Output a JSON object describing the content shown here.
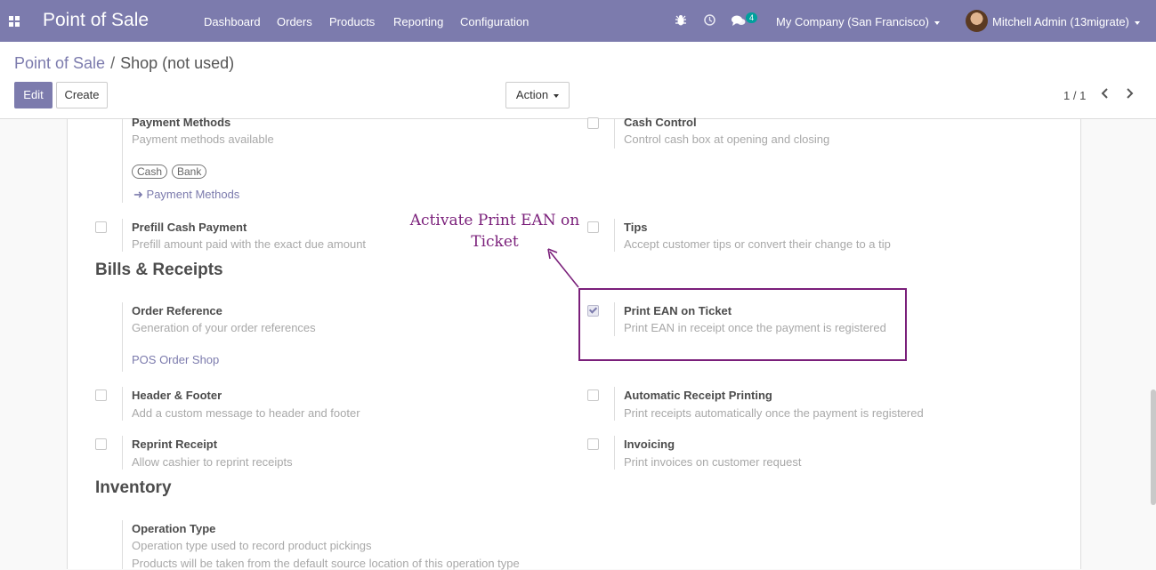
{
  "navbar": {
    "app_title": "Point of Sale",
    "menu": [
      "Dashboard",
      "Orders",
      "Products",
      "Reporting",
      "Configuration"
    ],
    "chat_count": "4",
    "company": "My Company (San Francisco)",
    "user": "Mitchell Admin (13migrate)",
    "colors": {
      "bar": "#7c7bad",
      "badge": "#00a09d"
    }
  },
  "breadcrumb": {
    "parent": "Point of Sale",
    "separator": "/",
    "current": "Shop (not used)"
  },
  "toolbar": {
    "edit": "Edit",
    "create": "Create",
    "action": "Action",
    "pager": "1 / 1"
  },
  "settings": {
    "payment_methods": {
      "label": "Payment Methods",
      "desc": "Payment methods available",
      "tags": [
        "Cash",
        "Bank"
      ],
      "link": "Payment Methods"
    },
    "cash_control": {
      "label": "Cash Control",
      "desc": "Control cash box at opening and closing",
      "checked": false
    },
    "prefill_cash": {
      "label": "Prefill Cash Payment",
      "desc": "Prefill amount paid with the exact due amount",
      "checked": false
    },
    "tips": {
      "label": "Tips",
      "desc": "Accept customer tips or convert their change to a tip",
      "checked": false
    }
  },
  "bills_section": {
    "title": "Bills & Receipts",
    "order_reference": {
      "label": "Order Reference",
      "desc": "Generation of your order references",
      "link": "POS Order Shop"
    },
    "print_ean": {
      "label": "Print EAN on Ticket",
      "desc": "Print EAN in receipt once the payment is registered",
      "checked": true
    },
    "header_footer": {
      "label": "Header & Footer",
      "desc": "Add a custom message to header and footer",
      "checked": false
    },
    "auto_receipt": {
      "label": "Automatic Receipt Printing",
      "desc": "Print receipts automatically once the payment is registered",
      "checked": false
    },
    "reprint": {
      "label": "Reprint Receipt",
      "desc": "Allow cashier to reprint receipts",
      "checked": false
    },
    "invoicing": {
      "label": "Invoicing",
      "desc": "Print invoices on customer request",
      "checked": false
    }
  },
  "inventory_section": {
    "title": "Inventory",
    "operation_type": {
      "label": "Operation Type",
      "desc": "Operation type used to record product pickings",
      "desc2": "Products will be taken from the default source location of this operation type"
    }
  },
  "annotation": {
    "text": "Activate Print EAN on Ticket",
    "color": "#7a1f7a"
  }
}
